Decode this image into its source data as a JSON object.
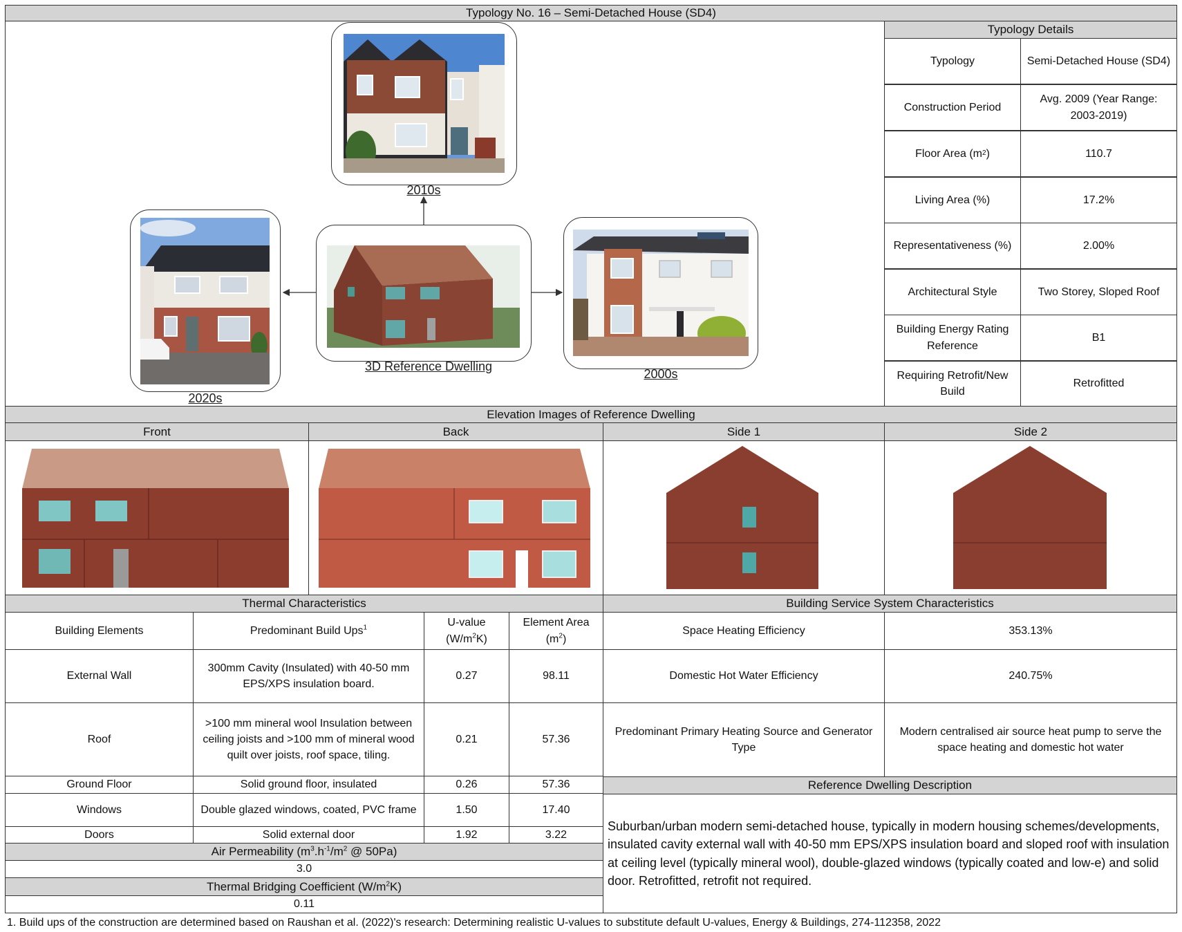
{
  "title": "Typology No. 16 – Semi-Detached House (SD4)",
  "details": {
    "header": "Typology Details",
    "rows": [
      {
        "label": "Typology",
        "value": "Semi-Detached House (SD4)"
      },
      {
        "label": "Construction Period",
        "value": "Avg. 2009 (Year Range: 2003-2019)"
      },
      {
        "label": "Floor Area (m",
        "label_sup": "2",
        "label_end": ")",
        "value": "110.7"
      },
      {
        "label": "Living Area (%)",
        "value": "17.2%"
      },
      {
        "label": "Representativeness (%)",
        "value": "2.00%"
      },
      {
        "label": "Architectural Style",
        "value": "Two Storey, Sloped Roof"
      },
      {
        "label": "Building Energy Rating Reference",
        "value": "B1"
      },
      {
        "label": "Requiring Retrofit/New Build",
        "value": "Retrofitted"
      }
    ]
  },
  "diagram": {
    "label_2010s": "2010s",
    "label_2020s": "2020s",
    "label_3d": "3D Reference Dwelling",
    "label_2000s": "2000s"
  },
  "elevations": {
    "header": "Elevation Images of Reference Dwelling",
    "columns": [
      "Front",
      "Back",
      "Side 1",
      "Side 2"
    ]
  },
  "thermal": {
    "header": "Thermal Characteristics",
    "col_elements": "Building Elements",
    "col_buildups": "Predominant Build Ups",
    "col_buildups_sup": "1",
    "col_uvalue_1": "U-value",
    "col_uvalue_2a": "(W/m",
    "col_uvalue_2sup": "2",
    "col_uvalue_2b": "K)",
    "col_area_1": "Element Area",
    "col_area_2a": "(m",
    "col_area_2sup": "2",
    "col_area_2b": ")",
    "rows": [
      {
        "element": "External Wall",
        "buildup": "300mm Cavity (Insulated) with 40-50 mm EPS/XPS insulation board.",
        "u": "0.27",
        "area": "98.11"
      },
      {
        "element": "Roof",
        "buildup": ">100 mm mineral wool Insulation between ceiling joists and >100 mm of mineral wood quilt over joists, roof space, tiling.",
        "u": "0.21",
        "area": "57.36"
      },
      {
        "element": "Ground Floor",
        "buildup": "Solid ground floor, insulated",
        "u": "0.26",
        "area": "57.36"
      },
      {
        "element": "Windows",
        "buildup": "Double glazed windows, coated, PVC frame",
        "u": "1.50",
        "area": "17.40"
      },
      {
        "element": "Doors",
        "buildup": "Solid external door",
        "u": "1.92",
        "area": "3.22"
      }
    ],
    "air_perm_a": "Air Permeability (m",
    "air_perm_sup1": "3",
    "air_perm_b": ".h",
    "air_perm_sup2": "-1",
    "air_perm_c": "/m",
    "air_perm_sup3": "2",
    "air_perm_d": " @ 50Pa)",
    "air_perm_value": "3.0",
    "tbc_a": "Thermal Bridging Coefficient (W/m",
    "tbc_sup": "2",
    "tbc_b": "K)",
    "tbc_value": "0.11"
  },
  "services": {
    "header": "Building Service System Characteristics",
    "rows": [
      {
        "label": "Space Heating Efficiency",
        "value": "353.13%"
      },
      {
        "label": "Domestic Hot Water Efficiency",
        "value": "240.75%"
      },
      {
        "label": "Predominant Primary Heating Source and Generator Type",
        "value": "Modern centralised air source heat pump to serve the space heating and domestic hot water"
      }
    ]
  },
  "description": {
    "header": "Reference Dwelling Description",
    "text": "Suburban/urban modern semi-detached house, typically in modern housing schemes/developments, insulated cavity external wall with 40-50 mm EPS/XPS insulation board and sloped roof with insulation at ceiling level (typically mineral wool), double-glazed windows (typically coated and low-e) and solid door. Retrofitted, retrofit not required."
  },
  "footnote": "1. Build ups of the construction are determined based on Raushan et al. (2022)'s research: Determining realistic U-values to substitute default U-values, Energy & Buildings, 274-112358, 2022"
}
